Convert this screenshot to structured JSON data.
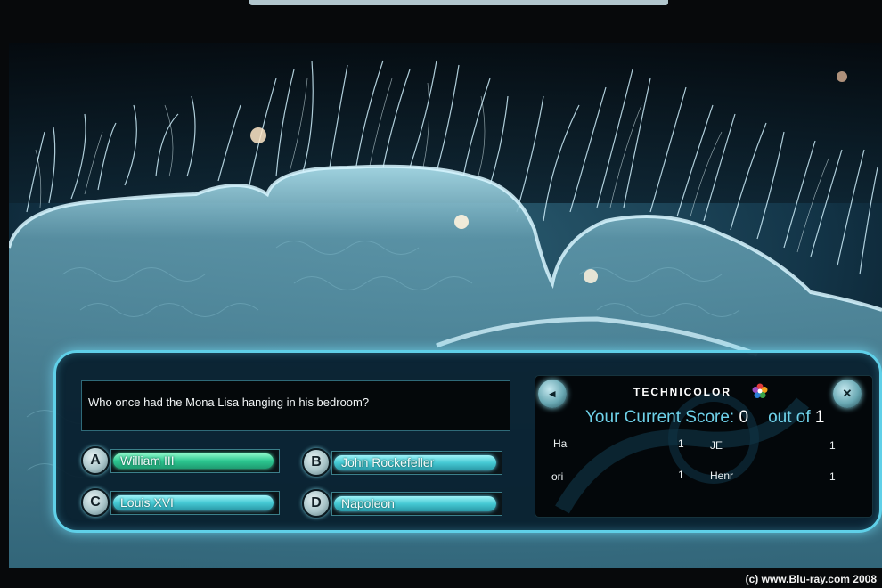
{
  "quiz": {
    "question": "Who once had the Mona Lisa hanging in his bedroom?",
    "answers": [
      {
        "letter": "A",
        "text": "William III",
        "style": "selected"
      },
      {
        "letter": "B",
        "text": "John Rockefeller",
        "style": "default"
      },
      {
        "letter": "C",
        "text": "Louis XVI",
        "style": "default"
      },
      {
        "letter": "D",
        "text": "Napoleon",
        "style": "default"
      }
    ]
  },
  "scoreboard": {
    "brand": "TECHNICOLOR",
    "left_orb_icon": "navigation-orb-icon",
    "right_orb_icon": "close-orb-icon",
    "score_label": "Your Current Score:",
    "score_value": "0",
    "out_of_label": "out of",
    "out_of_value": "1",
    "players": [
      {
        "name": "Ha",
        "score": "1"
      },
      {
        "name": "JE",
        "score": "1"
      },
      {
        "name": "ori",
        "score": "1"
      },
      {
        "name": "Henr",
        "score": "1"
      }
    ]
  },
  "watermark": "(c) www.Blu-ray.com 2008",
  "colors": {
    "frame_glow": "#5fd0e8",
    "score_label": "#6fd2ea",
    "selected_answer": "#2cc790",
    "default_answer": "#45c9d4"
  }
}
